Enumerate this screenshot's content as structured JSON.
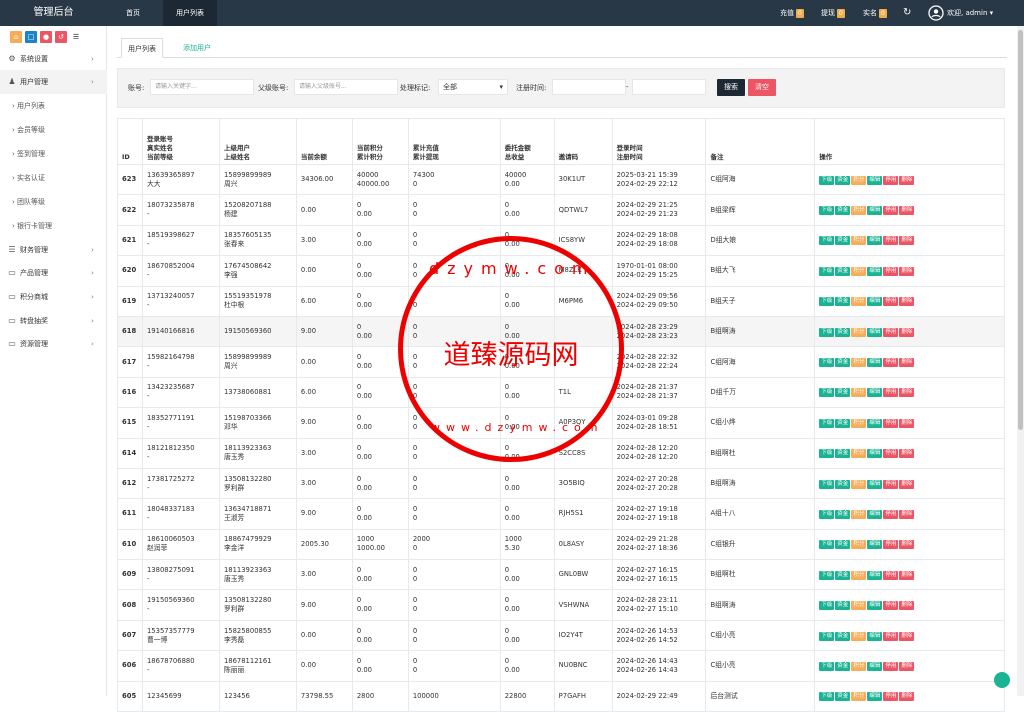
{
  "brand": "管理后台",
  "nav": {
    "home": "首页",
    "users": "用户列表"
  },
  "topright": {
    "recharge": "充值",
    "recharge_count": "0",
    "withdraw": "提现",
    "withdraw_count": "0",
    "realname": "实名",
    "realname_count": "0",
    "welcome": "欢迎, admin"
  },
  "sidebar": {
    "menus": [
      {
        "label": "系统设置",
        "icon": "gears-icon"
      },
      {
        "label": "用户管理",
        "icon": "user-icon"
      }
    ],
    "subs": [
      "用户列表",
      "会员等级",
      "签到管理",
      "实名认证",
      "团队等级",
      "银行卡管理"
    ],
    "menus2": [
      {
        "label": "财务管理",
        "icon": "database-icon"
      },
      {
        "label": "产品管理",
        "icon": "monitor-icon"
      },
      {
        "label": "积分商城",
        "icon": "monitor-icon"
      },
      {
        "label": "转盘抽奖",
        "icon": "monitor-icon"
      },
      {
        "label": "资源管理",
        "icon": "monitor-icon"
      }
    ]
  },
  "tabs": {
    "list": "用户列表",
    "add": "添加用户"
  },
  "filter": {
    "account_label": "账号:",
    "account_ph": "请输入关键字...",
    "parent_label": "父级账号:",
    "parent_ph": "请输入父级账号...",
    "mark_label": "处理标记:",
    "mark_value": "全部",
    "time_label": "注册时间:",
    "dash": "-",
    "search": "搜索",
    "clear": "清空"
  },
  "table": {
    "headers": {
      "id": "ID",
      "account": [
        "登录账号",
        "真实姓名",
        "当前等级"
      ],
      "parent": [
        "上级用户",
        "上级姓名"
      ],
      "balance": "当前余额",
      "points": [
        "当前积分",
        "累计积分"
      ],
      "recharge": [
        "累计充值",
        "累计提现"
      ],
      "entrust": [
        "委托金额",
        "总收益"
      ],
      "invite": "邀请码",
      "time": [
        "登录时间",
        "注册时间"
      ],
      "remark": "备注",
      "ops": "操作"
    },
    "actions": [
      "下级",
      "资金",
      "积分",
      "编辑",
      "停用",
      "删除"
    ],
    "rows": [
      {
        "id": "623",
        "acc": "13639365897",
        "name": "大大",
        "pacc": "15899899989",
        "pname": "周兴",
        "bal": "34306.00",
        "pt1": "40000",
        "pt2": "40000.00",
        "rc1": "74300",
        "rc2": "0",
        "en1": "40000",
        "en2": "0.00",
        "code": "30K1UT",
        "t1": "2025-03-21 15:39",
        "t2": "2024-02-29 22:12",
        "remark": "C组阿海"
      },
      {
        "id": "622",
        "acc": "18073235878",
        "name": "-",
        "pacc": "15208207188",
        "pname": "杨建",
        "bal": "0.00",
        "pt1": "0",
        "pt2": "0.00",
        "rc1": "0",
        "rc2": "0",
        "en1": "0",
        "en2": "0.00",
        "code": "QDTWL7",
        "t1": "2024-02-29 21:25",
        "t2": "2024-02-29 21:23",
        "remark": "B组梁辉"
      },
      {
        "id": "621",
        "acc": "18519398627",
        "name": "-",
        "pacc": "18357605135",
        "pname": "张春来",
        "bal": "3.00",
        "pt1": "0",
        "pt2": "0.00",
        "rc1": "0",
        "rc2": "0",
        "en1": "0",
        "en2": "0.00",
        "code": "ICS8YW",
        "t1": "2024-02-29 18:08",
        "t2": "2024-02-29 18:08",
        "remark": "D组大娘"
      },
      {
        "id": "620",
        "acc": "18670852004",
        "name": "-",
        "pacc": "17674508642",
        "pname": "李强",
        "bal": "0.00",
        "pt1": "0",
        "pt2": "0.00",
        "rc1": "0",
        "rc2": "0",
        "en1": "0",
        "en2": "0.00",
        "code": "M8ZLK",
        "t1": "1970-01-01 08:00",
        "t2": "2024-02-29 15:25",
        "remark": "B组大飞"
      },
      {
        "id": "619",
        "acc": "13713240057",
        "name": "-",
        "pacc": "15519351978",
        "pname": "杜中根",
        "bal": "6.00",
        "pt1": "0",
        "pt2": "0.00",
        "rc1": "0",
        "rc2": "0",
        "en1": "0",
        "en2": "0.00",
        "code": "M6PM6",
        "t1": "2024-02-29 09:56",
        "t2": "2024-02-29 09:50",
        "remark": "B组天子"
      },
      {
        "id": "618",
        "acc": "19140166816",
        "name": "",
        "pacc": "19150569360",
        "pname": "",
        "bal": "9.00",
        "pt1": "0",
        "pt2": "0.00",
        "rc1": "0",
        "rc2": "0",
        "en1": "0",
        "en2": "0.00",
        "code": "",
        "t1": "2024-02-28 23:29",
        "t2": "2024-02-28 23:23",
        "remark": "B组啊涛"
      },
      {
        "id": "617",
        "acc": "15982164798",
        "name": "-",
        "pacc": "15899899989",
        "pname": "周兴",
        "bal": "0.00",
        "pt1": "0",
        "pt2": "0.00",
        "rc1": "0",
        "rc2": "0",
        "en1": "0",
        "en2": "0.00",
        "code": "",
        "t1": "2024-02-28 22:32",
        "t2": "2024-02-28 22:24",
        "remark": "C组阿海"
      },
      {
        "id": "616",
        "acc": "13423235687",
        "name": "-",
        "pacc": "13738060881",
        "pname": "",
        "bal": "6.00",
        "pt1": "0",
        "pt2": "0.00",
        "rc1": "0",
        "rc2": "0",
        "en1": "0",
        "en2": "0.00",
        "code": "T1L",
        "t1": "2024-02-28 21:37",
        "t2": "2024-02-28 21:37",
        "remark": "D组千万"
      },
      {
        "id": "615",
        "acc": "18352771191",
        "name": "-",
        "pacc": "15198703366",
        "pname": "邓华",
        "bal": "9.00",
        "pt1": "0",
        "pt2": "0.00",
        "rc1": "0",
        "rc2": "0",
        "en1": "0",
        "en2": "0.00",
        "code": "A0P3QY",
        "t1": "2024-03-01 09:28",
        "t2": "2024-02-28 18:51",
        "remark": "C组小烨"
      },
      {
        "id": "614",
        "acc": "18121812350",
        "name": "-",
        "pacc": "18113923363",
        "pname": "唐玉秀",
        "bal": "3.00",
        "pt1": "0",
        "pt2": "0.00",
        "rc1": "0",
        "rc2": "0",
        "en1": "0",
        "en2": "0.00",
        "code": "S2CC8S",
        "t1": "2024-02-28 12:20",
        "t2": "2024-02-28 12:20",
        "remark": "B组啊杜"
      },
      {
        "id": "612",
        "acc": "17381725272",
        "name": "-",
        "pacc": "13508132280",
        "pname": "罗利群",
        "bal": "3.00",
        "pt1": "0",
        "pt2": "0.00",
        "rc1": "0",
        "rc2": "0",
        "en1": "0",
        "en2": "0.00",
        "code": "3O5BIQ",
        "t1": "2024-02-27 20:28",
        "t2": "2024-02-27 20:28",
        "remark": "B组啊涛"
      },
      {
        "id": "611",
        "acc": "18048337183",
        "name": "-",
        "pacc": "13634718871",
        "pname": "王淑芳",
        "bal": "9.00",
        "pt1": "0",
        "pt2": "0.00",
        "rc1": "0",
        "rc2": "0",
        "en1": "0",
        "en2": "0.00",
        "code": "RJH5S1",
        "t1": "2024-02-27 19:18",
        "t2": "2024-02-27 19:18",
        "remark": "A组十八"
      },
      {
        "id": "610",
        "acc": "18610060503",
        "name": "赵润菲",
        "pacc": "18867479929",
        "pname": "李金洋",
        "bal": "2005.30",
        "pt1": "1000",
        "pt2": "1000.00",
        "rc1": "2000",
        "rc2": "0",
        "en1": "1000",
        "en2": "5.30",
        "code": "0L8ASY",
        "t1": "2024-02-29 21:28",
        "t2": "2024-02-27 18:36",
        "remark": "C组银升"
      },
      {
        "id": "609",
        "acc": "13808275091",
        "name": "-",
        "pacc": "18113923363",
        "pname": "唐玉秀",
        "bal": "3.00",
        "pt1": "0",
        "pt2": "0.00",
        "rc1": "0",
        "rc2": "0",
        "en1": "0",
        "en2": "0.00",
        "code": "GNL0BW",
        "t1": "2024-02-27 16:15",
        "t2": "2024-02-27 16:15",
        "remark": "B组啊杜"
      },
      {
        "id": "608",
        "acc": "19150569360",
        "name": "-",
        "pacc": "13508132280",
        "pname": "罗利群",
        "bal": "9.00",
        "pt1": "0",
        "pt2": "0.00",
        "rc1": "0",
        "rc2": "0",
        "en1": "0",
        "en2": "0.00",
        "code": "VSHWNA",
        "t1": "2024-02-28 23:11",
        "t2": "2024-02-27 15:10",
        "remark": "B组啊涛"
      },
      {
        "id": "607",
        "acc": "15357357779",
        "name": "曹一博",
        "pacc": "15825800855",
        "pname": "李秀磊",
        "bal": "0.00",
        "pt1": "0",
        "pt2": "0.00",
        "rc1": "0",
        "rc2": "0",
        "en1": "0",
        "en2": "0.00",
        "code": "IO2Y4T",
        "t1": "2024-02-26 14:53",
        "t2": "2024-02-26 14:52",
        "remark": "C组小亮"
      },
      {
        "id": "606",
        "acc": "18678706880",
        "name": "-",
        "pacc": "18678112161",
        "pname": "陈丽丽",
        "bal": "0.00",
        "pt1": "0",
        "pt2": "0.00",
        "rc1": "0",
        "rc2": "0",
        "en1": "0",
        "en2": "0.00",
        "code": "NU0BNC",
        "t1": "2024-02-26 14:43",
        "t2": "2024-02-26 14:43",
        "remark": "C组小亮"
      },
      {
        "id": "605",
        "acc": "12345699",
        "name": "",
        "pacc": "123456",
        "pname": "",
        "bal": "73798.55",
        "pt1": "2800",
        "pt2": "",
        "rc1": "100000",
        "rc2": "",
        "en1": "22800",
        "en2": "",
        "code": "P7GAFH",
        "t1": "2024-02-29 22:49",
        "t2": "",
        "remark": "后台测试"
      }
    ]
  },
  "watermark": {
    "title": "道臻源码网",
    "url_top": "dzymw.com",
    "url_bottom": "www.dzymw.com"
  },
  "colors": {
    "topbar": "#293846",
    "green": "#1ab394",
    "orange": "#f8ac59",
    "red": "#ed5565",
    "badge": "#f0ad4e",
    "search": "#1c2833"
  }
}
